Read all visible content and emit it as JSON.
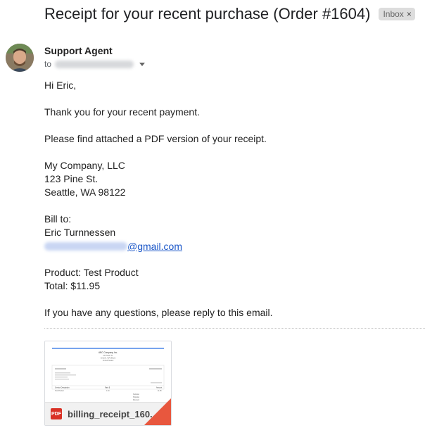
{
  "email": {
    "subject": "Receipt for your recent purchase (Order #1604)",
    "label": "Inbox",
    "label_close": "×",
    "sender": "Support Agent",
    "to_prefix": "to"
  },
  "body": {
    "greeting": "Hi Eric,",
    "line1": "Thank you for your recent payment.",
    "line2": "Please find attached a PDF version of your receipt.",
    "company": [
      "My Company, LLC",
      "123 Pine St.",
      "Seattle, WA 98122"
    ],
    "bill_to_label": "Bill to:",
    "bill_to_name": "Eric Turnnessen",
    "bill_to_email_domain": "@gmail.com",
    "product": "Product: Test Product",
    "total": "Total: $11.95",
    "closing": "If you have any questions, please reply to this email."
  },
  "attachment": {
    "filename": "billing_receipt_160...",
    "type_label": "PDF",
    "preview": {
      "company": "ABC Company Inc.",
      "address_lines": [
        "123 Main St.",
        "Seattle, WA 98122",
        "United States"
      ],
      "headers": [
        "Service Description",
        "Rate $",
        "Amount"
      ],
      "row": [
        "Test Product",
        "1.00",
        "11.95"
      ],
      "totals": [
        "Subtotal",
        "Shipping",
        "Discount"
      ]
    }
  },
  "colors": {
    "link": "#1a56c8",
    "pdf": "#d93025",
    "preview_rule": "#4a86e8"
  }
}
